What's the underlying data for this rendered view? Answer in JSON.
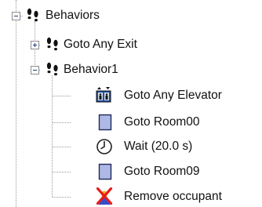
{
  "tree": {
    "root": {
      "label": "Behaviors",
      "expander": "collapse",
      "icon": "footprints-icon"
    },
    "nodes": [
      {
        "label": "Goto Any Exit",
        "expander": "expand",
        "icon": "footprints-icon"
      },
      {
        "label": "Behavior1",
        "expander": "collapse",
        "icon": "footprints-icon"
      }
    ],
    "actions": [
      {
        "label": "Goto Any Elevator",
        "icon": "elevator-icon"
      },
      {
        "label": "Goto Room00",
        "icon": "room-icon"
      },
      {
        "label": "Wait (20.0 s)",
        "icon": "clock-icon"
      },
      {
        "label": "Goto Room09",
        "icon": "room-icon"
      },
      {
        "label": "Remove occupant",
        "icon": "remove-occupant-icon"
      }
    ]
  }
}
